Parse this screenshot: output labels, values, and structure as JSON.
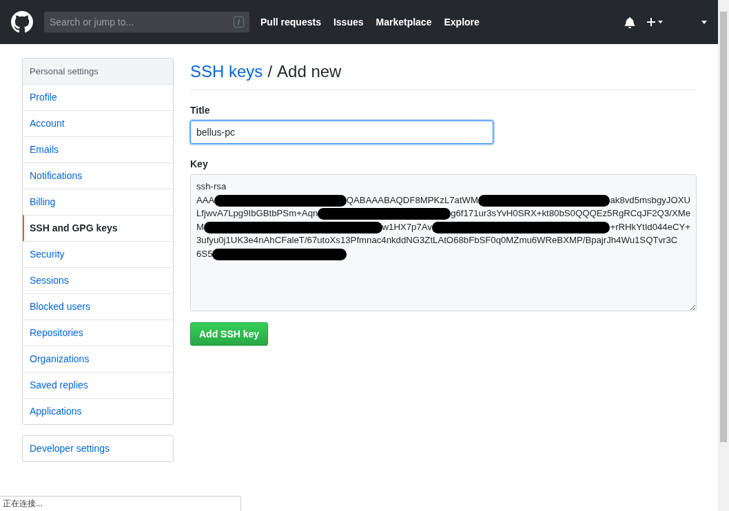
{
  "header": {
    "search": {
      "placeholder": "Search or jump to...",
      "shortcut": "/"
    },
    "nav": [
      "Pull requests",
      "Issues",
      "Marketplace",
      "Explore"
    ]
  },
  "sidebar": {
    "heading": "Personal settings",
    "items": [
      {
        "label": "Profile",
        "selected": false
      },
      {
        "label": "Account",
        "selected": false
      },
      {
        "label": "Emails",
        "selected": false
      },
      {
        "label": "Notifications",
        "selected": false
      },
      {
        "label": "Billing",
        "selected": false
      },
      {
        "label": "SSH and GPG keys",
        "selected": true
      },
      {
        "label": "Security",
        "selected": false
      },
      {
        "label": "Sessions",
        "selected": false
      },
      {
        "label": "Blocked users",
        "selected": false
      },
      {
        "label": "Repositories",
        "selected": false
      },
      {
        "label": "Organizations",
        "selected": false
      },
      {
        "label": "Saved replies",
        "selected": false
      },
      {
        "label": "Applications",
        "selected": false
      }
    ],
    "developer": "Developer settings"
  },
  "page": {
    "breadcrumb": "SSH keys",
    "separator": "/",
    "title": "Add new"
  },
  "form": {
    "title_label": "Title",
    "title_value": "bellus-pc",
    "key_label": "Key",
    "key_lines": [
      [
        {
          "kind": "text",
          "text": "ssh-rsa"
        }
      ],
      [
        {
          "kind": "text",
          "text": "AAA"
        },
        {
          "kind": "redacted"
        },
        {
          "kind": "text",
          "text": "QABAAABAQDF8MPKzL7atWM"
        },
        {
          "kind": "redacted"
        },
        {
          "kind": "text",
          "text": "ak8vd5msbgyJOXU"
        }
      ],
      [
        {
          "kind": "text",
          "text": "LfjwvA7Lpg9IbGBtbPSm+Aqn"
        },
        {
          "kind": "redacted"
        },
        {
          "kind": "text",
          "text": "g6f171ur3sYvH0SRX+kt80bS0QQQEz5RgRCqJF2Q3/XMe"
        }
      ],
      [
        {
          "kind": "text",
          "text": "M"
        },
        {
          "kind": "redacted"
        },
        {
          "kind": "text",
          "text": "w1HX7p7Av"
        },
        {
          "kind": "redacted"
        },
        {
          "kind": "text",
          "text": "+rRHkYtId044eCY+"
        }
      ],
      [
        {
          "kind": "text",
          "text": "3ufyu0j1UK3e4nAhCFaleT/67utoXs13Pfmnac4nkddNG3ZtLAtO68bFbSF0q0MZmu6WReBXMP/BpajrJh4Wu1SQTvr3C"
        }
      ],
      [
        {
          "kind": "text",
          "text": "6S5"
        },
        {
          "kind": "redacted"
        }
      ]
    ],
    "submit": "Add SSH key"
  },
  "status_bar": "正在连接..."
}
